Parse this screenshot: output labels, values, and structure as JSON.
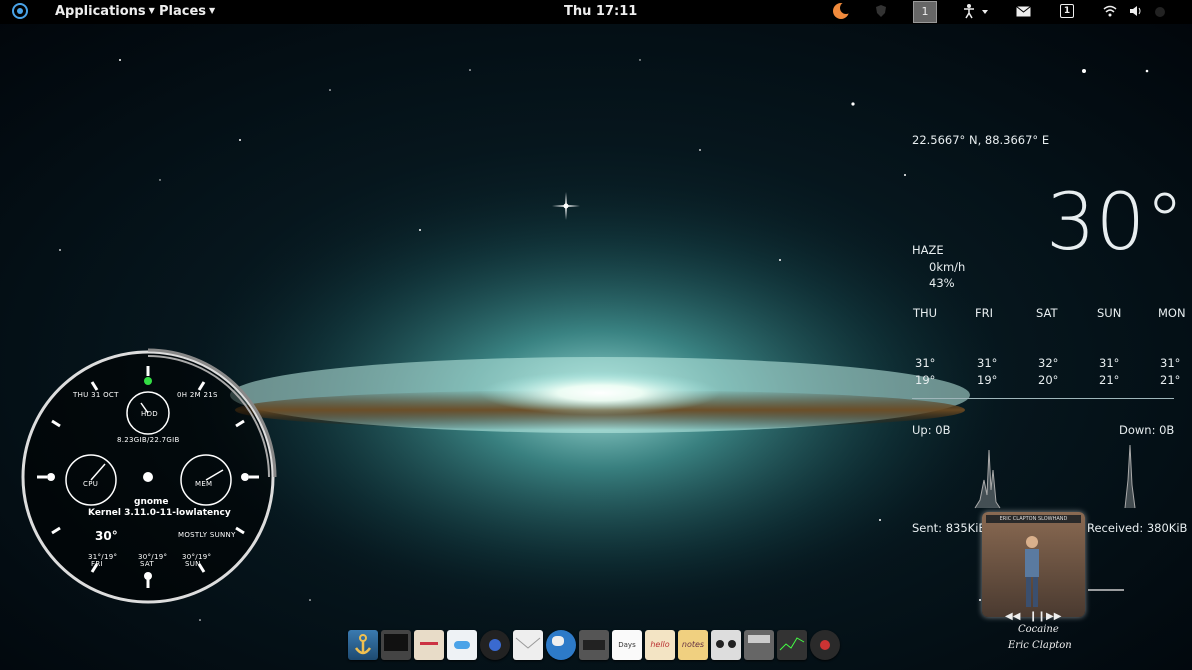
{
  "panel": {
    "applications_label": "Applications",
    "places_label": "Places",
    "clock": "Thu 17:11",
    "workspace": "1",
    "workspace_box": "1"
  },
  "weather": {
    "coords": "22.5667° N, 88.3667° E",
    "temperature": "30°",
    "condition": "HAZE",
    "wind": "0km/h",
    "humidity": "43%",
    "forecast": [
      {
        "day": "THU",
        "high": "31°",
        "low": "19°"
      },
      {
        "day": "FRI",
        "high": "31°",
        "low": "19°"
      },
      {
        "day": "SAT",
        "high": "32°",
        "low": "20°"
      },
      {
        "day": "SUN",
        "high": "31°",
        "low": "21°"
      },
      {
        "day": "MON",
        "high": "31°",
        "low": "21°"
      }
    ]
  },
  "network": {
    "up": "Up: 0B",
    "down": "Down: 0B",
    "sent": "Sent: 835KiB",
    "received": "Received: 380KiB"
  },
  "music": {
    "album_banner": "ERIC CLAPTON SLOWHAND",
    "title": "Cocaine",
    "artist": "Eric Clapton"
  },
  "clock_widget": {
    "date": "THU 31 OCT",
    "uptime": "0H 2M 21S",
    "hdd_label": "HDD",
    "disk": "8.23GiB/22.7GiB",
    "cpu_label": "CPU",
    "mem_label": "MEM",
    "hostname": "gnome",
    "kernel": "Kernel 3.11.0-11-lowlatency",
    "temperature": "30°",
    "condition": "MOSTLY SUNNY",
    "forecast": [
      {
        "temps": "31°/19°",
        "day": "FRI"
      },
      {
        "temps": "30°/19°",
        "day": "SAT"
      },
      {
        "temps": "30°/19°",
        "day": "SUN"
      }
    ]
  },
  "dock": {
    "icons": [
      "anchor-icon",
      "monitor-icon",
      "document-editor-icon",
      "toggle-switch-icon",
      "camera-lens-icon",
      "mail-envelope-icon",
      "globe-icon",
      "printer-icon",
      "calendar-icon",
      "hello-note-icon",
      "notes-icon",
      "speaker-icon",
      "radio-player-icon",
      "system-monitor-icon",
      "record-player-icon"
    ],
    "days_label": "Days",
    "hello_label": "hello",
    "notes_label": "notes"
  },
  "colors": {
    "galaxy_glow": "#9fe6e0",
    "dust_lane": "#5a3a1a",
    "panel_bg": "#000000",
    "clock_green": "#33dd44"
  }
}
